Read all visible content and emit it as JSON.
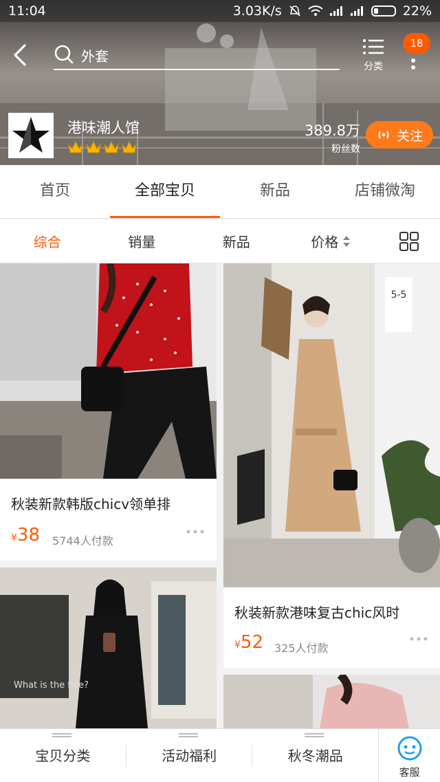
{
  "status_bar": {
    "time": "11:04",
    "speed": "3.03K/s",
    "battery": "22%"
  },
  "header": {
    "search_text": "外套",
    "category_label": "分类",
    "badge_count": "18"
  },
  "store": {
    "name": "港味潮人馆",
    "fans_count": "389.8万",
    "fans_label": "粉丝数",
    "follow_label": "关注",
    "crown_count": 4
  },
  "tabs": [
    {
      "label": "首页"
    },
    {
      "label": "全部宝贝"
    },
    {
      "label": "新品"
    },
    {
      "label": "店铺微淘"
    }
  ],
  "sort": {
    "items": [
      {
        "label": "综合"
      },
      {
        "label": "销量"
      },
      {
        "label": "新品"
      },
      {
        "label": "价格"
      }
    ]
  },
  "products": [
    {
      "title": "秋装新款韩版chicv领单排",
      "currency": "¥",
      "price": "38",
      "sold": "5744人付款"
    },
    {
      "title": "秋装新款港味复古chic风时",
      "currency": "¥",
      "price": "52",
      "sold": "325人付款"
    }
  ],
  "bottom_bar": {
    "items": [
      {
        "label": "宝贝分类"
      },
      {
        "label": "活动福利"
      },
      {
        "label": "秋冬潮品"
      }
    ],
    "service_label": "客服"
  },
  "colors": {
    "accent": "#ff5a00",
    "follow": "#ff7a1a"
  }
}
